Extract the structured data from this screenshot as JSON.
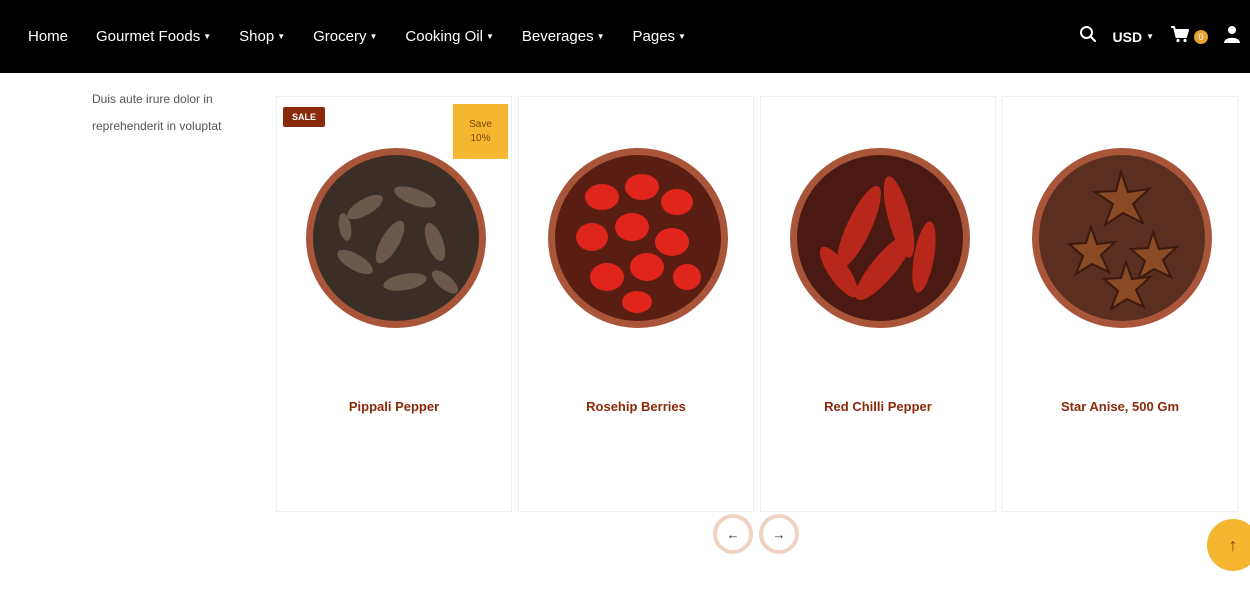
{
  "nav": {
    "items": [
      {
        "label": "Home",
        "caret": false
      },
      {
        "label": "Gourmet Foods",
        "caret": true
      },
      {
        "label": "Shop",
        "caret": true
      },
      {
        "label": "Grocery",
        "caret": true
      },
      {
        "label": "Cooking Oil",
        "caret": true
      },
      {
        "label": "Beverages",
        "caret": true
      },
      {
        "label": "Pages",
        "caret": true
      }
    ],
    "currency": "USD",
    "cart_count": "0",
    "icons": [
      "search-icon",
      "chevron-down-icon",
      "cart-icon",
      "user-icon"
    ],
    "background": "#000000"
  },
  "sidebar": {
    "text": "Duis aute irure dolor in reprehenderit in voluptat"
  },
  "products": [
    {
      "name": "Pippali Pepper",
      "sale_badge": "SALE",
      "save_badge_line1": "Save",
      "save_badge_line2": "10%",
      "image": "long-pepper-bowl"
    },
    {
      "name": "Rosehip Berries",
      "image": "rosehip-bowl"
    },
    {
      "name": "Red Chilli Pepper",
      "image": "red-chilli-bowl"
    },
    {
      "name": "Star Anise, 500 Gm",
      "image": "star-anise-bowl"
    }
  ],
  "carousel": {
    "prev_icon": "arrow-left-icon",
    "next_icon": "arrow-right-icon"
  },
  "scroll_top_icon": "arrow-up-icon",
  "colors": {
    "accent": "#f5b731",
    "brand_dark": "#8a2a0a",
    "button_ring": "#f0d2c3"
  }
}
